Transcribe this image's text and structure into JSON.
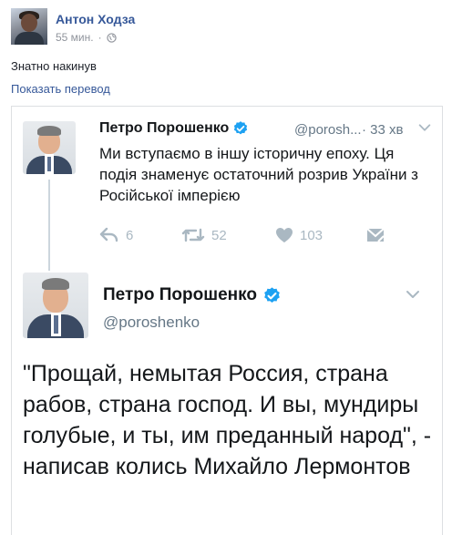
{
  "facebook_post": {
    "author_name": "Антон Ходза",
    "time": "55 мин.",
    "separator": "·",
    "post_text": "Знатно накинув",
    "translate_link": "Показать перевод"
  },
  "reply_tweet": {
    "author_name": "Петро Порошенко",
    "handle": "@porosh...",
    "time": "· 33 хв",
    "text": "Ми вступаємо в іншу історичну епоху. Ця подія знаменує остаточний розрив України з Російської імперією",
    "reply_count": "6",
    "retweet_count": "52",
    "like_count": "103"
  },
  "main_tweet": {
    "author_name": "Петро Порошенко",
    "handle": "@poroshenko",
    "text": "\"Прощай, немытая Россия, страна рабов, страна господ. И вы, мундиры голубые, и ты, им преданный народ\", - написав колись Михайло Лермонтов"
  },
  "colors": {
    "facebook_link": "#365899",
    "twitter_verified": "#1da1f2",
    "twitter_muted": "#657786",
    "action_icon": "#aab8c2"
  },
  "icons": [
    "globe-icon",
    "verified-icon",
    "chevron-down-icon",
    "reply-icon",
    "retweet-icon",
    "heart-icon",
    "direct-message-icon"
  ]
}
